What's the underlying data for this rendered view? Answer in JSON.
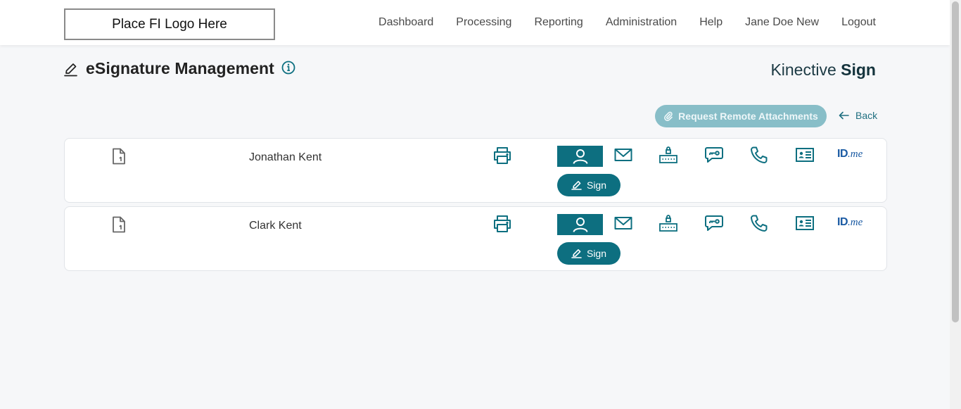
{
  "header": {
    "logo_text": "Place FI Logo Here",
    "nav": [
      "Dashboard",
      "Processing",
      "Reporting",
      "Administration",
      "Help",
      "Jane Doe New",
      "Logout"
    ]
  },
  "page": {
    "title": "eSignature Management",
    "brand_light": "Kinective",
    "brand_bold": "Sign"
  },
  "actions": {
    "request_label": "Request Remote Attachments",
    "back_label": "Back"
  },
  "signers": [
    {
      "name": "Jonathan Kent",
      "sign_label": "Sign"
    },
    {
      "name": "Clark Kent",
      "sign_label": "Sign"
    }
  ],
  "idme": {
    "id": "ID",
    "me": ".me"
  },
  "colors": {
    "accent": "#0d6f80",
    "disabled_button": "#88bec8",
    "background": "#f6f7f9"
  }
}
